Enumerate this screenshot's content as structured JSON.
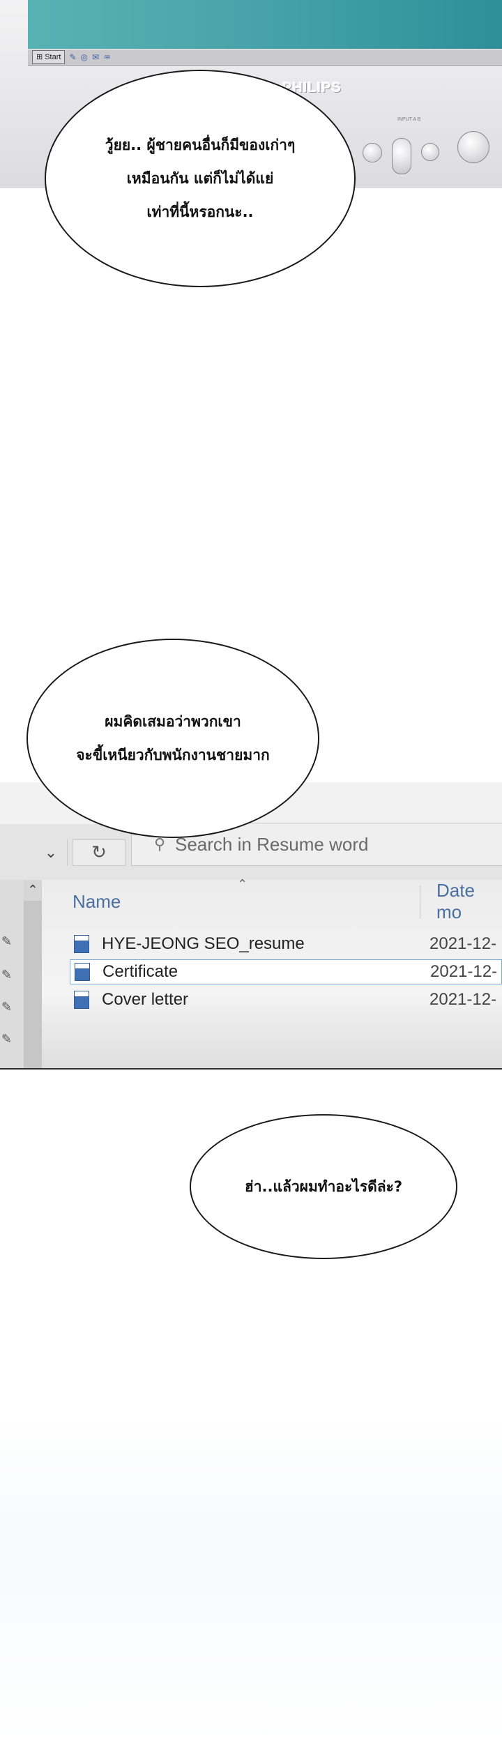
{
  "monitor": {
    "start_label": "Start",
    "brand": "PHILIPS",
    "control_label": "INPUT A B"
  },
  "bubbles": {
    "top": {
      "lines": [
        "วู้ยย.. ผู้ชายคนอื่นก็มีของเก่าๆ",
        "เหมือนกัน แต่ก็ไม่ได้แย่",
        "เท่าที่นี้หรอกนะ.."
      ]
    },
    "middle": {
      "lines": [
        "ผมคิดเสมอว่าพวกเขา",
        "จะขี้เหนียวกับพนักงานชายมาก"
      ]
    },
    "bottom": {
      "lines": [
        "ฮ่า..แล้วผมทำอะไรดีล่ะ?"
      ]
    }
  },
  "explorer": {
    "search_placeholder": "Search in Resume word",
    "columns": {
      "name": "Name",
      "date": "Date mo"
    },
    "files": [
      {
        "name": "HYE-JEONG SEO_resume",
        "date": "2021-12-",
        "selected": false
      },
      {
        "name": "Certificate",
        "date": "2021-12-",
        "selected": true
      },
      {
        "name": "Cover letter",
        "date": "2021-12-",
        "selected": false
      }
    ]
  }
}
